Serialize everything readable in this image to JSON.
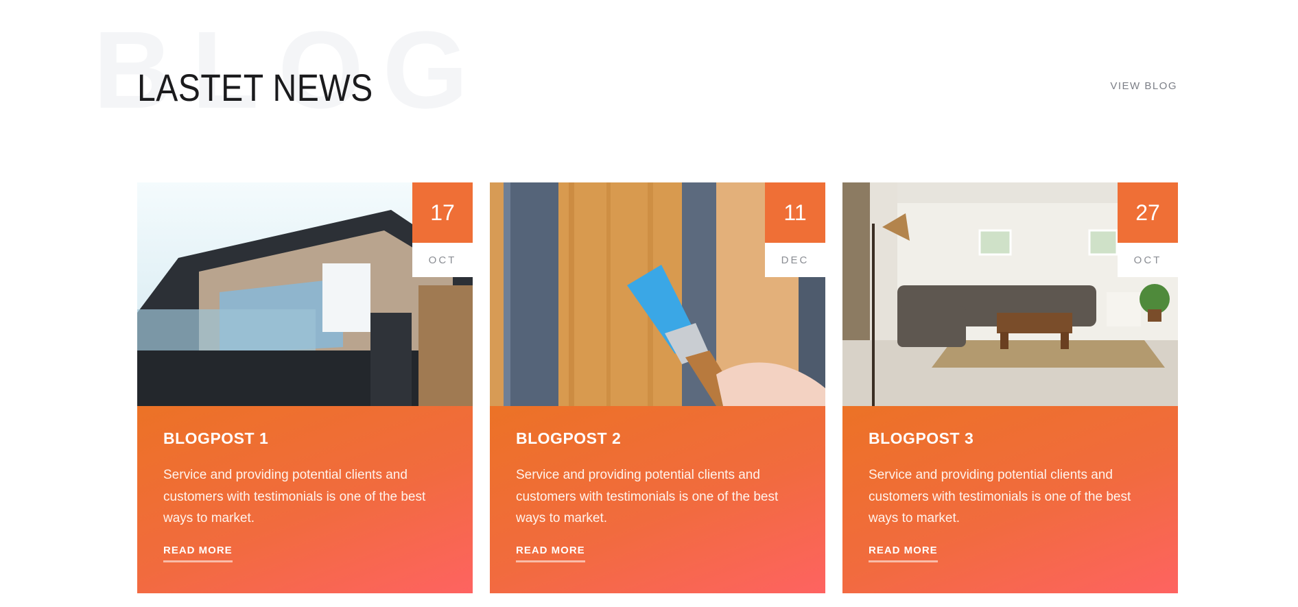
{
  "section": {
    "background_word": "BLOG",
    "heading": "LASTET NEWS",
    "view_blog_label": "VIEW BLOG"
  },
  "colors": {
    "accent": "#ef6f36",
    "gradient_start": "#ec7226",
    "gradient_end": "#fe6361",
    "heading": "#1b1b1d",
    "muted": "#7b7e86"
  },
  "posts": [
    {
      "day": "17",
      "month": "OCT",
      "title": "BLOGPOST 1",
      "excerpt": "Service and providing potential clients and customers with testimonials is one of the best ways to market.",
      "read_more": "READ MORE",
      "image": "modern-house-photo"
    },
    {
      "day": "11",
      "month": "DEC",
      "title": "BLOGPOST 2",
      "excerpt": "Service and providing potential clients and customers with testimonials is one of the best ways to market.",
      "read_more": "READ MORE",
      "image": "painting-wood-photo"
    },
    {
      "day": "27",
      "month": "OCT",
      "title": "BLOGPOST 3",
      "excerpt": "Service and providing potential clients and customers with testimonials is one of the best ways to market.",
      "read_more": "READ MORE",
      "image": "living-room-photo"
    }
  ]
}
